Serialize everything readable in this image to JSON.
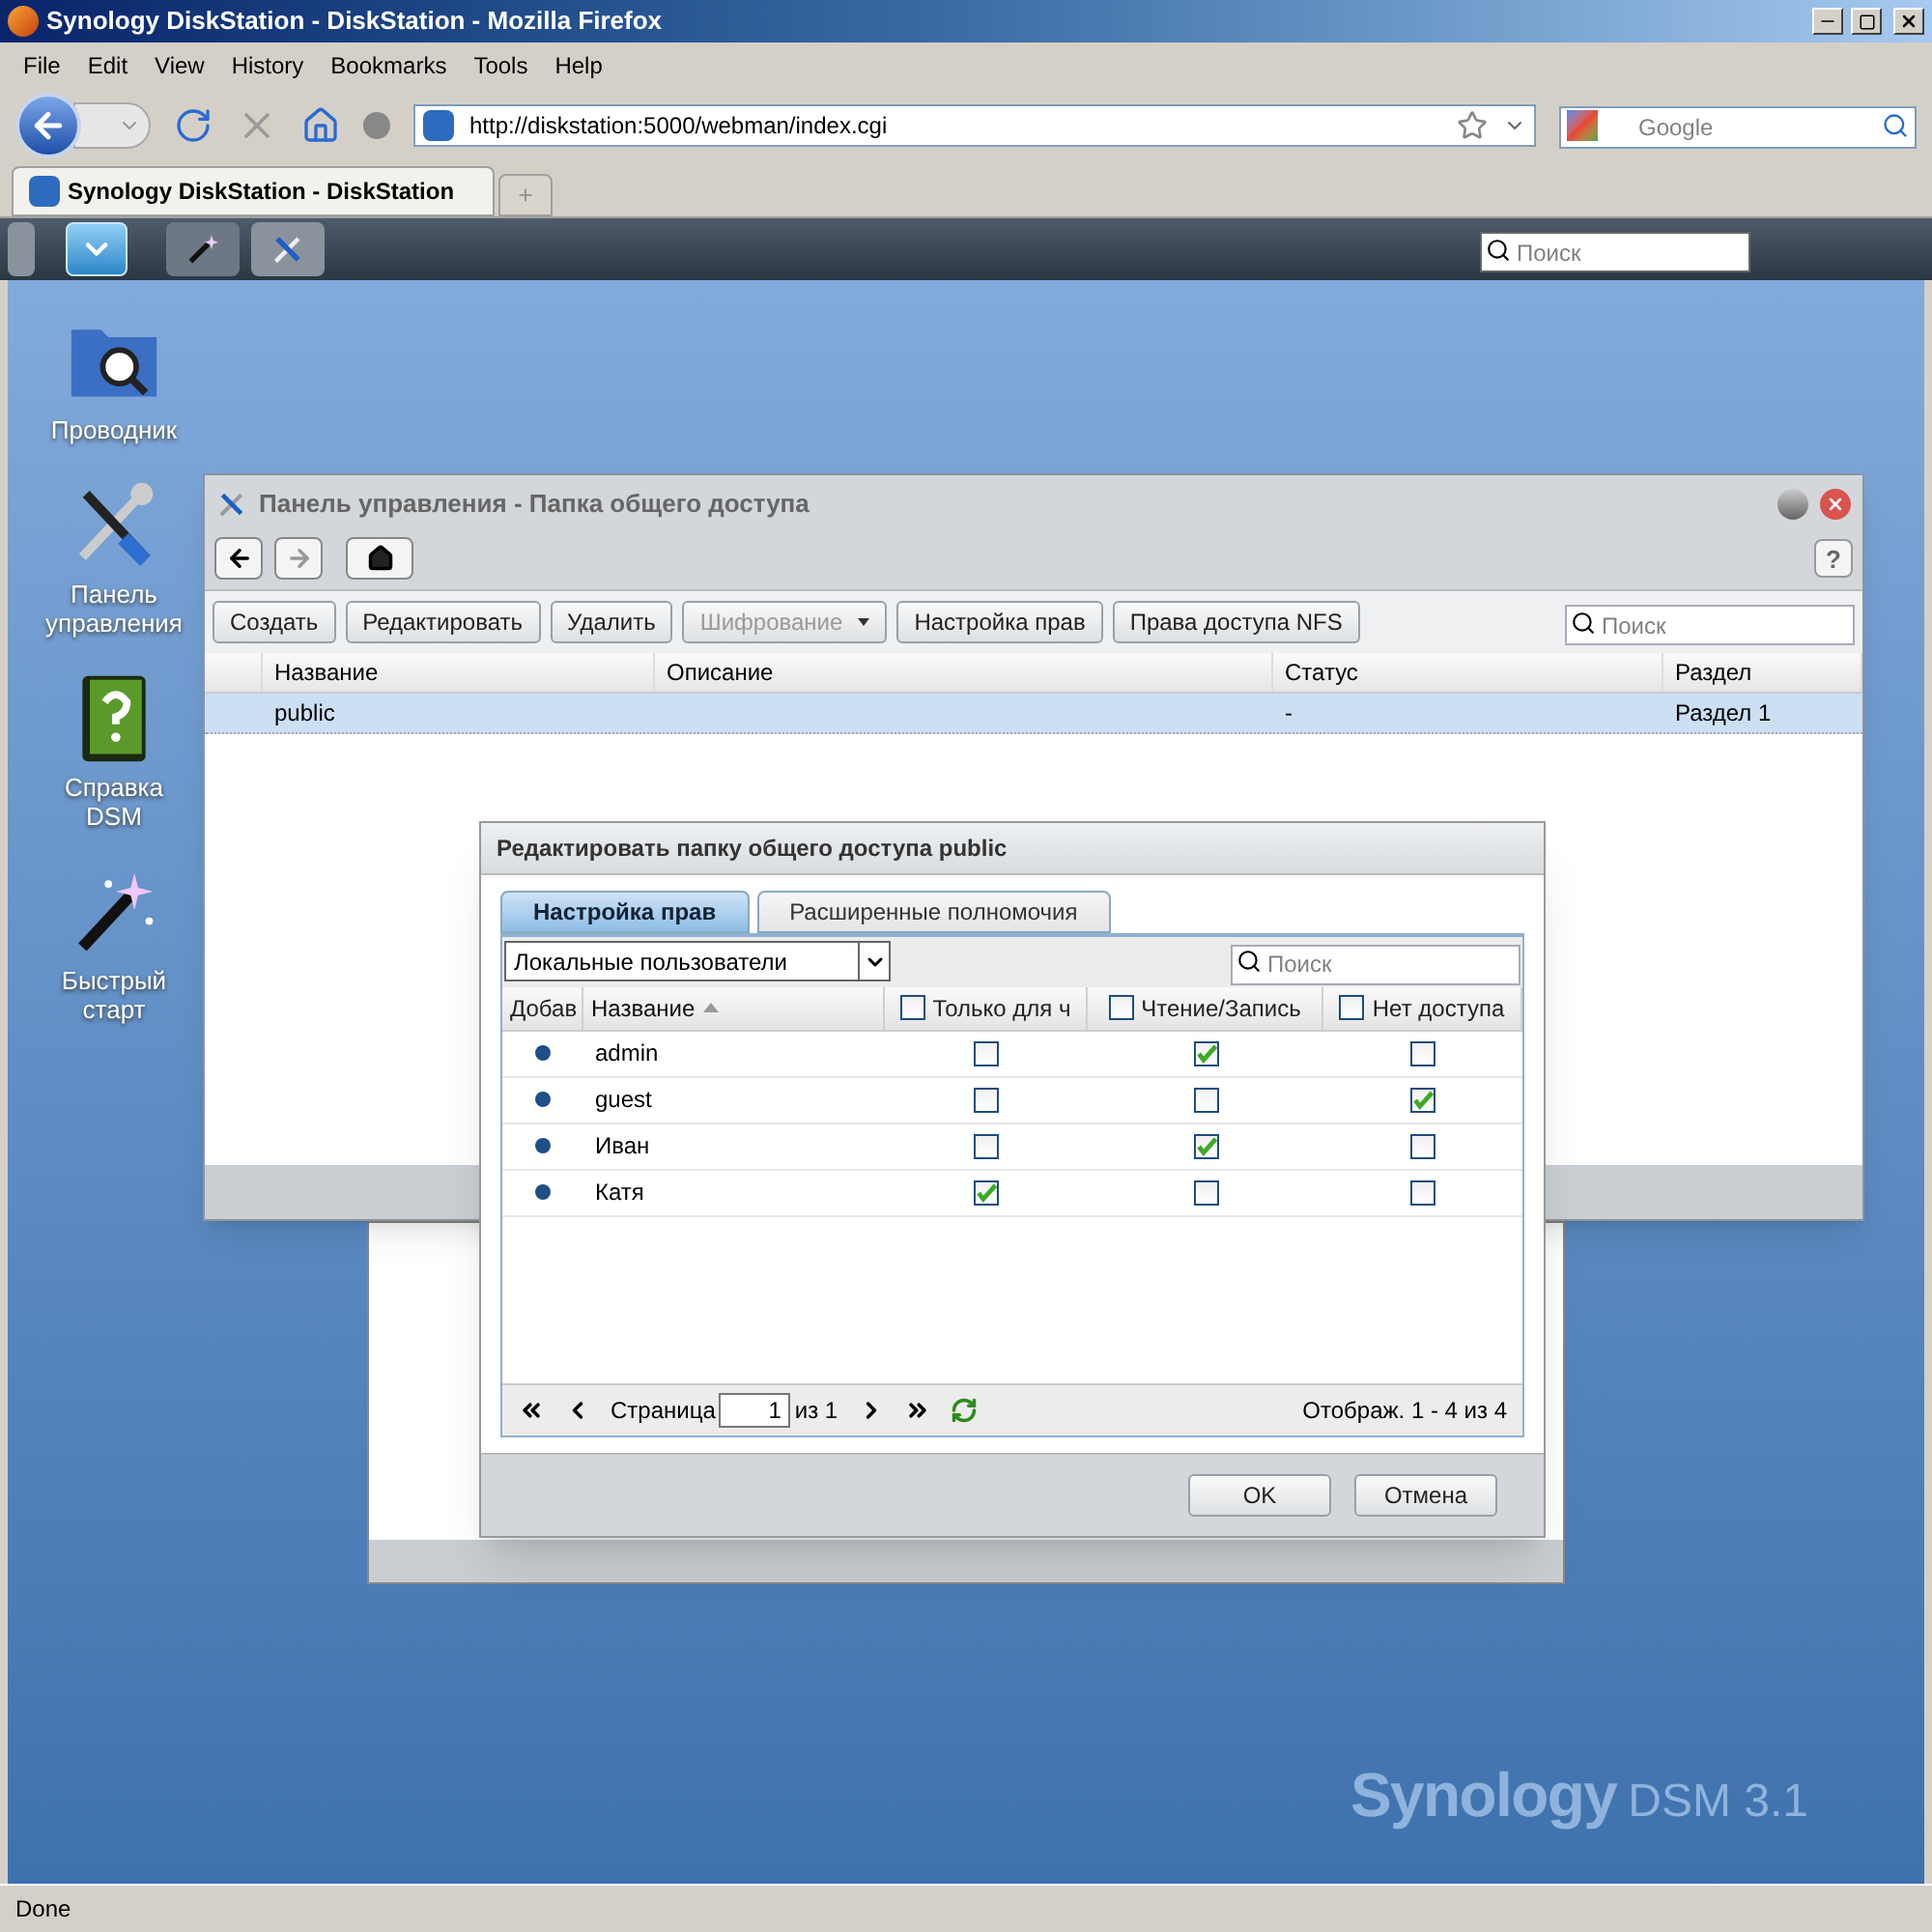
{
  "browser": {
    "title": "Synology DiskStation - DiskStation - Mozilla Firefox",
    "menu": [
      "File",
      "Edit",
      "View",
      "History",
      "Bookmarks",
      "Tools",
      "Help"
    ],
    "url": "http://diskstation:5000/webman/index.cgi",
    "search": {
      "placeholder": "Google"
    },
    "tabs": [
      {
        "label": "Synology DiskStation - DiskStation",
        "selected": true
      }
    ],
    "status": "Done"
  },
  "taskbar": {
    "search": {
      "placeholder": "Поиск"
    }
  },
  "desktop_icons": [
    {
      "label": "Проводник",
      "kind": "explorer"
    },
    {
      "label": "Панель управления",
      "kind": "control"
    },
    {
      "label": "Справка DSM",
      "kind": "help"
    },
    {
      "label": "Быстрый старт",
      "kind": "wizard"
    }
  ],
  "control_panel": {
    "title": "Панель управления - Папка общего доступа",
    "help": "?",
    "toolbar": [
      {
        "label": "Создать",
        "disabled": false,
        "dropdown": false
      },
      {
        "label": "Редактировать",
        "disabled": false,
        "dropdown": false
      },
      {
        "label": "Удалить",
        "disabled": false,
        "dropdown": false
      },
      {
        "label": "Шифрование",
        "disabled": true,
        "dropdown": true
      },
      {
        "label": "Настройка прав",
        "disabled": false,
        "dropdown": false
      },
      {
        "label": "Права доступа NFS",
        "disabled": false,
        "dropdown": false
      }
    ],
    "search": {
      "placeholder": "Поиск"
    },
    "columns": [
      "Название",
      "Описание",
      "Статус",
      "Раздел"
    ],
    "rows": [
      {
        "cells": [
          "public",
          "",
          "-",
          "Раздел 1"
        ],
        "selected": true
      }
    ]
  },
  "dialog": {
    "title": "Редактировать папку общего доступа public",
    "tabs": [
      {
        "label": "Настройка прав",
        "selected": true
      },
      {
        "label": "Расширенные полномочия",
        "selected": false
      }
    ],
    "filter": "Локальные пользователи",
    "search": {
      "placeholder": "Поиск"
    },
    "columns": [
      {
        "label": "Добав",
        "kind": "text",
        "sorted": false
      },
      {
        "label": "Название",
        "kind": "text",
        "sorted": true
      },
      {
        "label": "Только для ч",
        "kind": "checkbox",
        "checked": false
      },
      {
        "label": "Чтение/Запись",
        "kind": "checkbox",
        "checked": false
      },
      {
        "label": "Нет доступа",
        "kind": "checkbox",
        "checked": false
      }
    ],
    "users": [
      {
        "name": "admin",
        "access": [
          false,
          true,
          false
        ]
      },
      {
        "name": "guest",
        "access": [
          false,
          false,
          true
        ]
      },
      {
        "name": "Иван",
        "access": [
          false,
          true,
          false
        ]
      },
      {
        "name": "Катя",
        "access": [
          true,
          false,
          false
        ]
      }
    ],
    "pager": {
      "page_label": "Страница",
      "page": "1",
      "of": "из 1",
      "display": "Отображ. 1 - 4 из 4"
    },
    "buttons": [
      "OK",
      "Отмена"
    ]
  },
  "logo": {
    "brand": "Synology",
    "product": "DSM 3.1"
  }
}
